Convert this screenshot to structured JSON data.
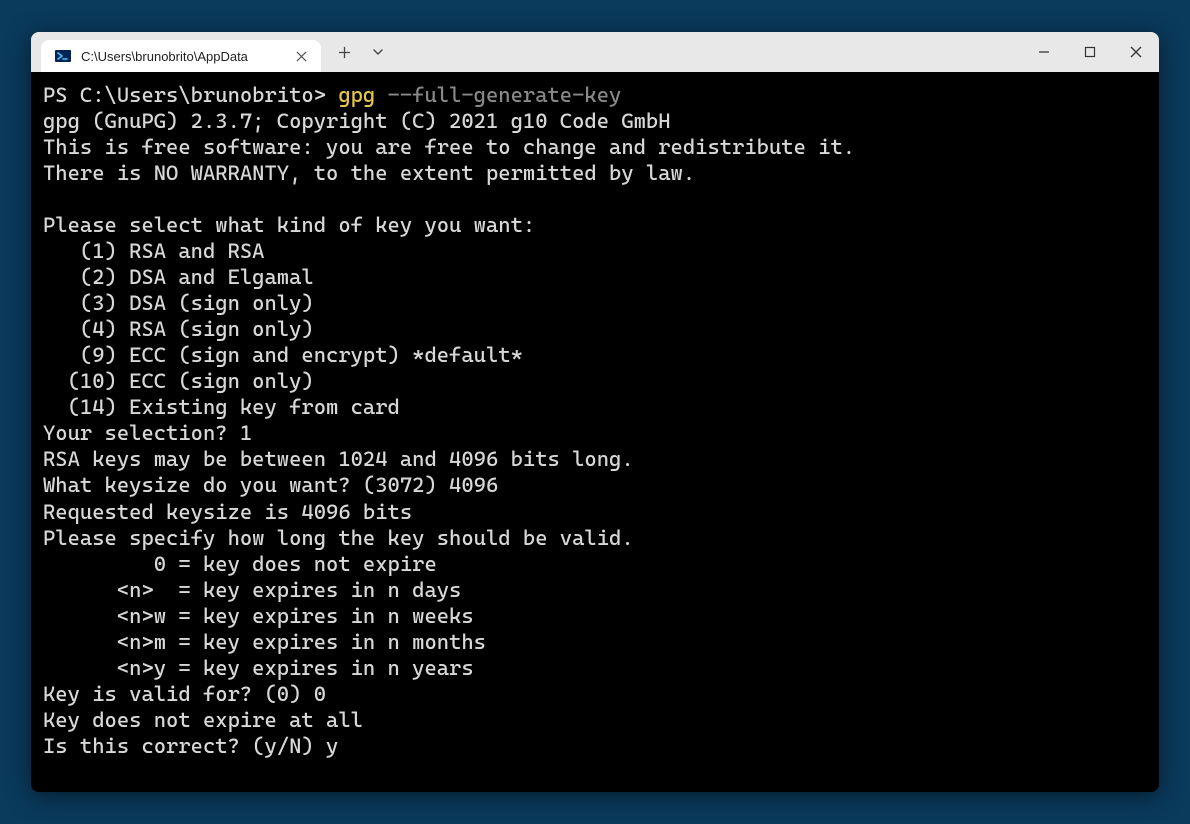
{
  "window": {
    "tab_title": "C:\\Users\\brunobrito\\AppData"
  },
  "terminal": {
    "prompt": "PS C:\\Users\\brunobrito> ",
    "command": "gpg",
    "args": " --full-generate-key",
    "lines": [
      "gpg (GnuPG) 2.3.7; Copyright (C) 2021 g10 Code GmbH",
      "This is free software: you are free to change and redistribute it.",
      "There is NO WARRANTY, to the extent permitted by law.",
      "",
      "Please select what kind of key you want:",
      "   (1) RSA and RSA",
      "   (2) DSA and Elgamal",
      "   (3) DSA (sign only)",
      "   (4) RSA (sign only)",
      "   (9) ECC (sign and encrypt) *default*",
      "  (10) ECC (sign only)",
      "  (14) Existing key from card",
      "Your selection? 1",
      "RSA keys may be between 1024 and 4096 bits long.",
      "What keysize do you want? (3072) 4096",
      "Requested keysize is 4096 bits",
      "Please specify how long the key should be valid.",
      "         0 = key does not expire",
      "      <n>  = key expires in n days",
      "      <n>w = key expires in n weeks",
      "      <n>m = key expires in n months",
      "      <n>y = key expires in n years",
      "Key is valid for? (0) 0",
      "Key does not expire at all",
      "Is this correct? (y/N) y"
    ]
  }
}
